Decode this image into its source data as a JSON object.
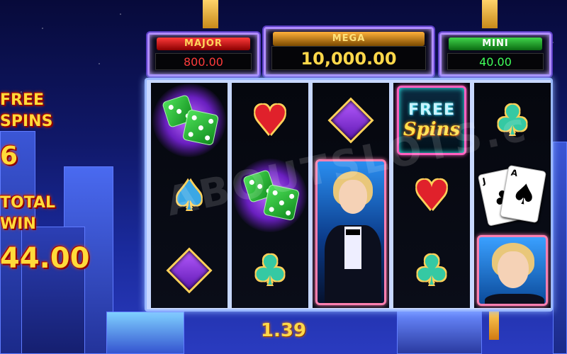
{
  "jackpots": {
    "major": {
      "title": "MAJOR",
      "value": "800.00",
      "color": "#ff3b3b"
    },
    "mega": {
      "title": "MEGA",
      "value": "10,000.00",
      "color": "#ffd84a"
    },
    "mini": {
      "title": "MINI",
      "value": "40.00",
      "color": "#3fff5a"
    }
  },
  "left_panel": {
    "free_spins_line1": "FREE",
    "free_spins_line2": "SPINS",
    "free_spins_count": "6",
    "total_win_line1": "TOTAL",
    "total_win_line2": "WIN",
    "total_win_value": "44.00"
  },
  "reels": [
    [
      "green-dice",
      "blue-spade",
      "purple-diamond"
    ],
    [
      "red-heart",
      "green-dice",
      "teal-club"
    ],
    [
      "purple-diamond",
      "lady-stacked",
      "lady-stacked"
    ],
    [
      "free-spins",
      "red-heart",
      "teal-club"
    ],
    [
      "teal-club",
      "playing-cards",
      "lady"
    ]
  ],
  "free_spins_symbol": {
    "line1": "FREE",
    "line2": "Spins"
  },
  "cards_symbol": {
    "card1_rank": "J",
    "card2_rank": "A"
  },
  "bet_value": "1.39",
  "watermark": "ABOUTSLOTS.c"
}
